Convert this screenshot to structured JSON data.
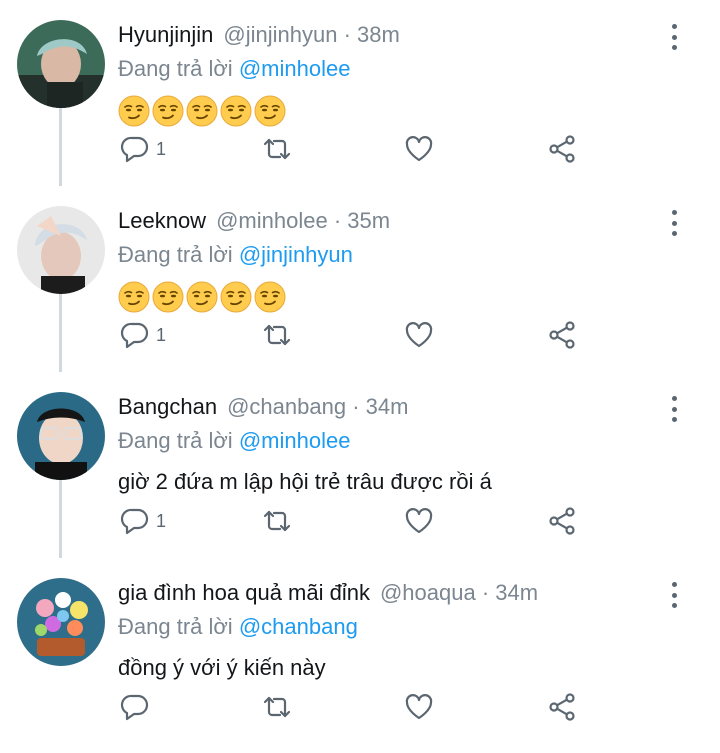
{
  "colors": {
    "link": "#1d9bf0",
    "muted": "#7b8690",
    "text": "#14171a",
    "thread_line": "#cfd9de"
  },
  "tweets": [
    {
      "avatar": "avatar-hyunjinjin",
      "name": "Hyunjinjin",
      "handle": "@jinjinhyun",
      "dot": "·",
      "time": "38m",
      "reply_prefix": "Đang trả lời",
      "reply_to": "@minholee",
      "text": "",
      "emoji_count": 5,
      "reply_count": "1"
    },
    {
      "avatar": "avatar-leeknow",
      "name": "Leeknow",
      "handle": "@minholee",
      "dot": "·",
      "time": "35m",
      "reply_prefix": "Đang trả lời",
      "reply_to": "@jinjinhyun",
      "text": "",
      "emoji_count": 5,
      "reply_count": "1"
    },
    {
      "avatar": "avatar-bangchan",
      "name": "Bangchan",
      "handle": "@chanbang",
      "dot": "·",
      "time": "34m",
      "reply_prefix": "Đang trả lời",
      "reply_to": "@minholee",
      "text": "giờ 2 đứa m lập hội trẻ trâu được rồi á",
      "emoji_count": 0,
      "reply_count": "1"
    },
    {
      "avatar": "avatar-hoaqua",
      "name": "gia đình hoa quả mãi đỉnk",
      "handle": "@hoaqua",
      "dot": "·",
      "time": "34m",
      "reply_prefix": "Đang trả lời",
      "reply_to": "@chanbang",
      "text": "đồng ý với ý kiến này",
      "emoji_count": 0,
      "reply_count": ""
    }
  ]
}
